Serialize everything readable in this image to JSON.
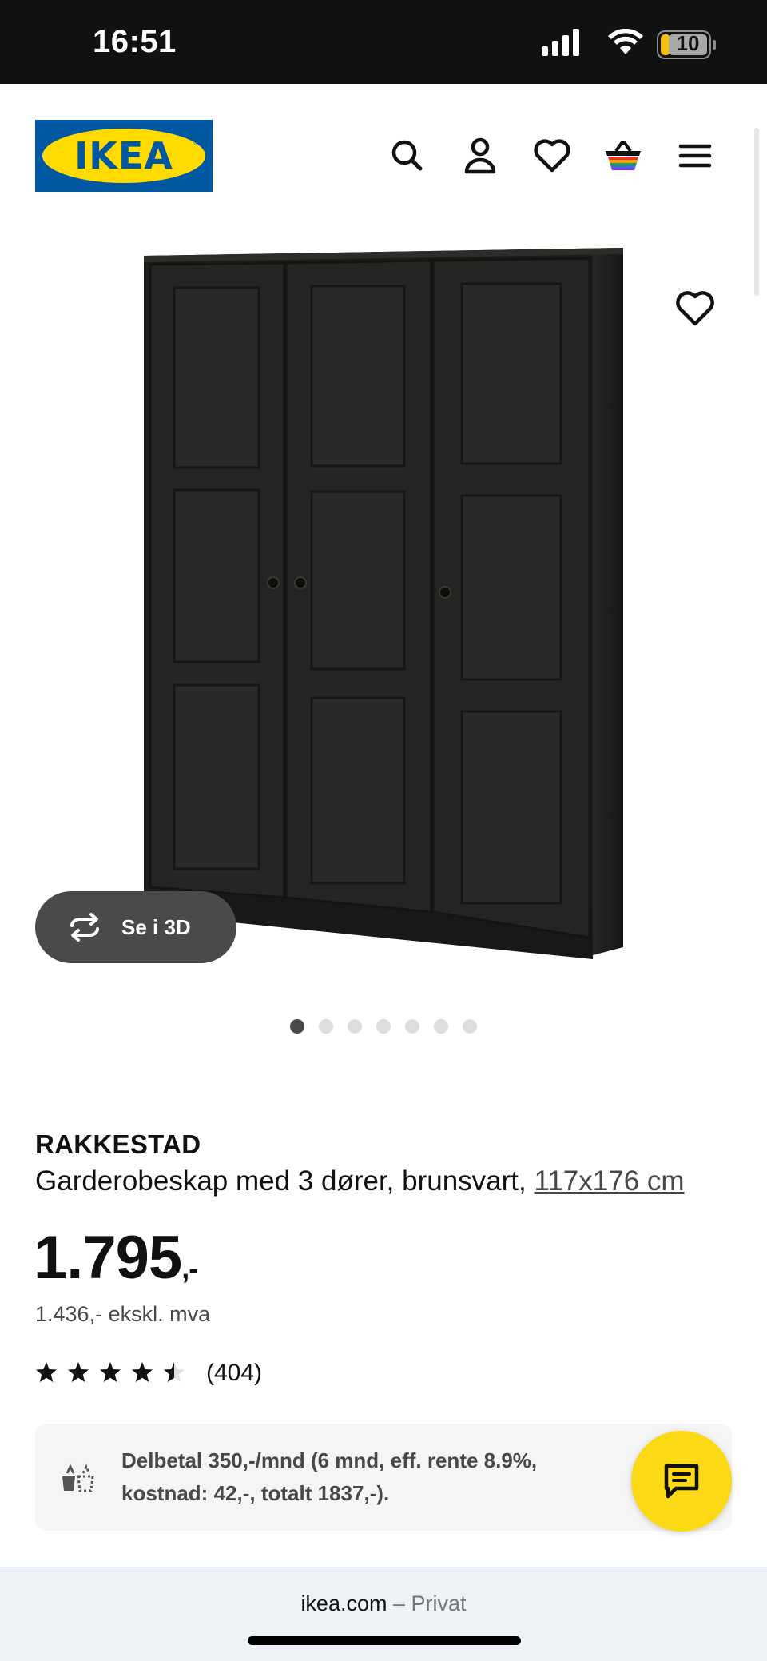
{
  "status_bar": {
    "time": "16:51",
    "battery": "10"
  },
  "header": {
    "logo_text": "IKEA",
    "logo_mark": "®",
    "icons": [
      "search-icon",
      "user-icon",
      "heart-icon",
      "cart-icon",
      "menu-icon"
    ]
  },
  "gallery": {
    "view3d_label": "Se i 3D",
    "dot_count": 7,
    "active_dot": 0
  },
  "product": {
    "name": "RAKKESTAD",
    "description": "Garderobeskap med 3 dører, brunsvart, ",
    "size": "117x176 cm",
    "price": "1.795",
    "price_suffix": ",-",
    "price_ex_vat": "1.436,- ekskl. mva",
    "rating": 4.5,
    "rating_max": 5,
    "review_count": "(404)"
  },
  "finance": {
    "line1": "Delbetal 350,-/mnd (6 mnd, eff. rente 8.9%,",
    "line2": "kostnad: 42,-, totalt 1837,-)."
  },
  "browser": {
    "domain": "ikea.com",
    "separator": " – ",
    "mode": "Privat"
  },
  "colors": {
    "ikea_blue": "#0058a3",
    "ikea_yellow": "#ffdb00",
    "chat_yellow": "#fbd914",
    "wardrobe": "#1e1c1a"
  }
}
